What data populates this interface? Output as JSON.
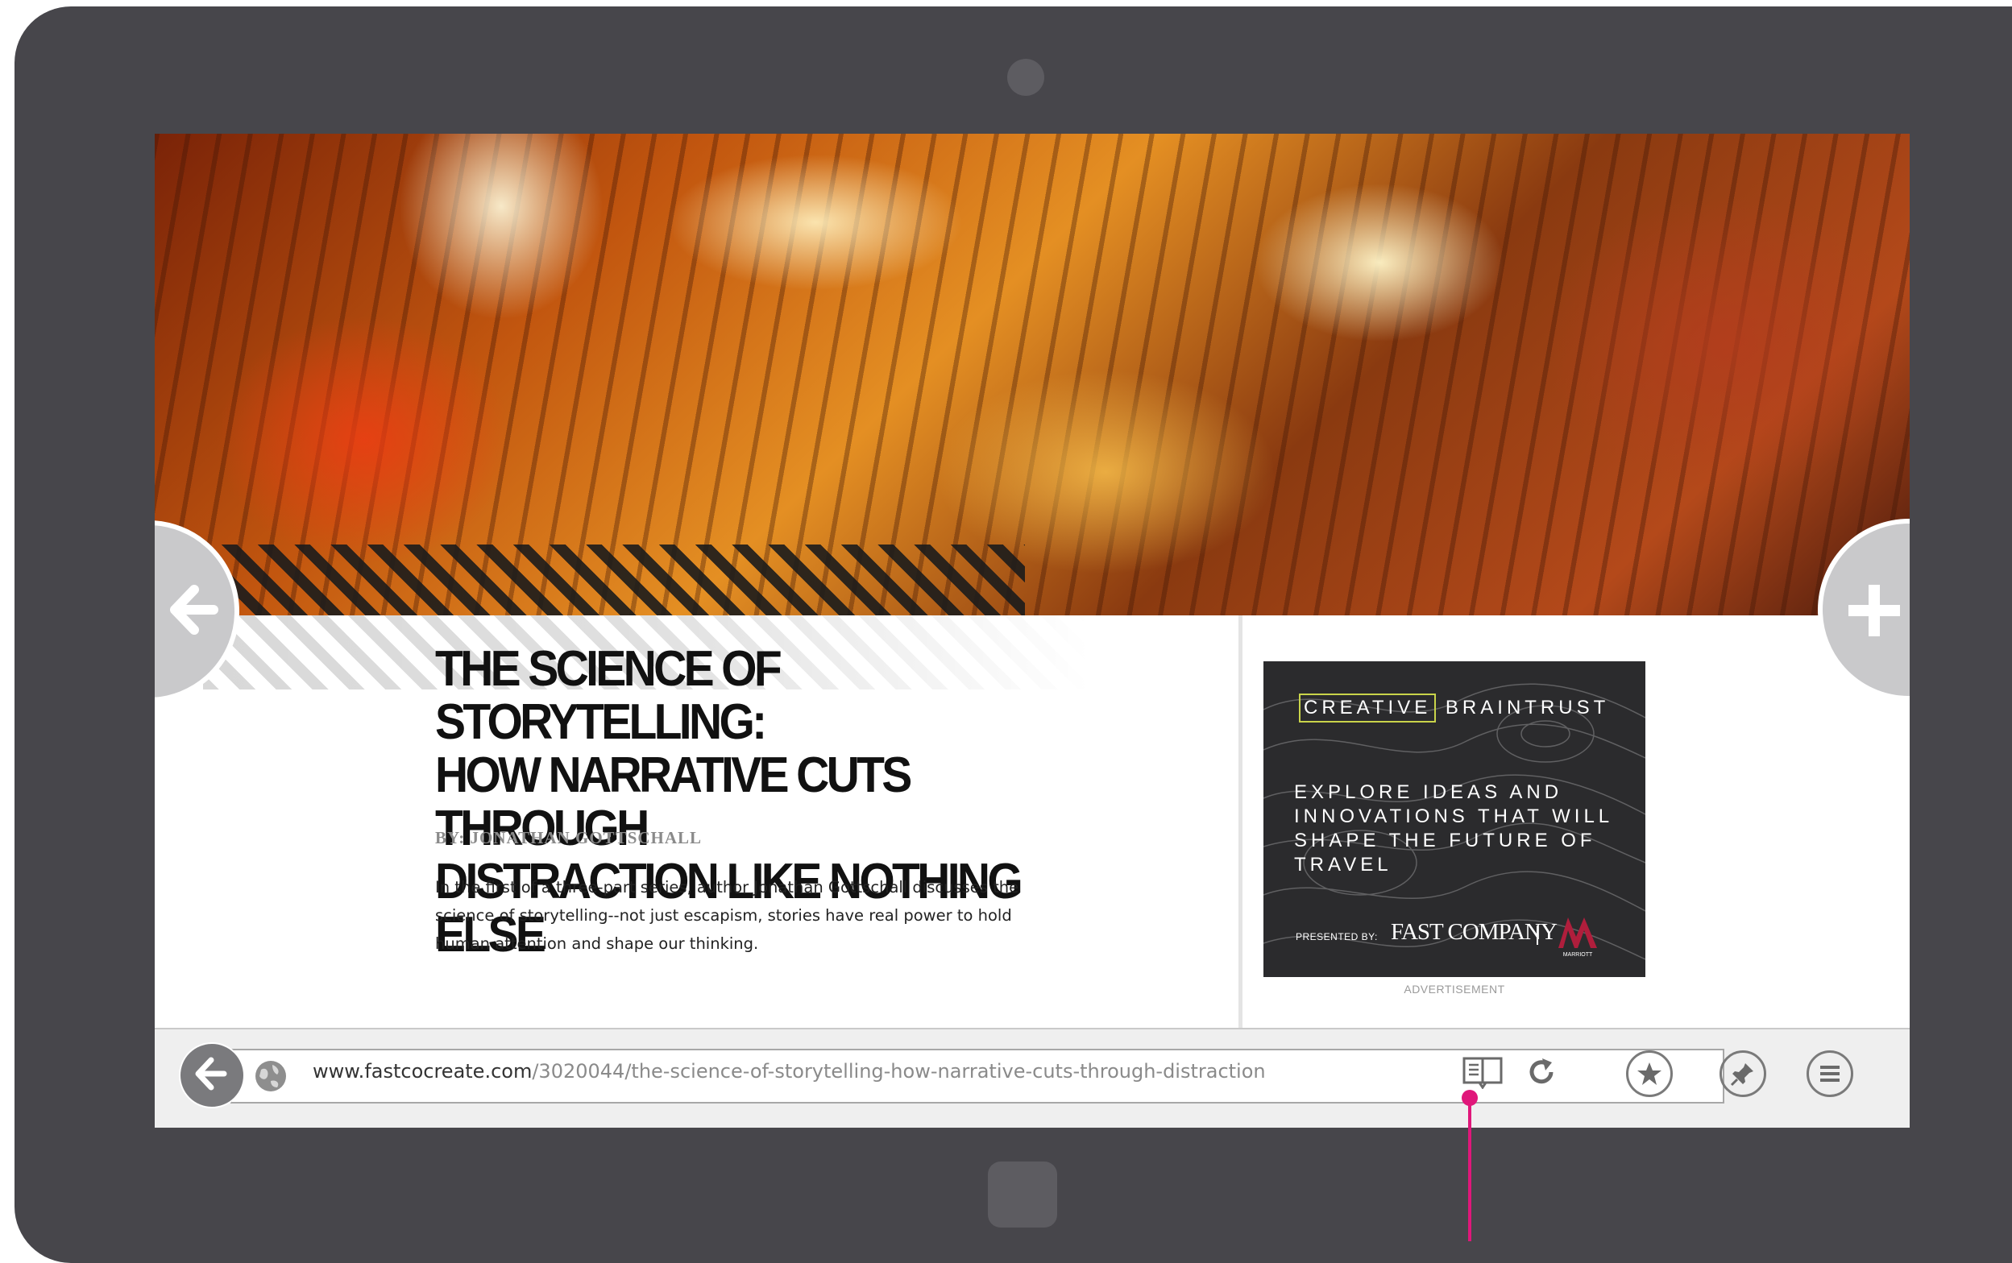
{
  "article": {
    "headline_line1": "THE SCIENCE OF STORYTELLING:",
    "headline_line2": "HOW NARRATIVE CUTS THROUGH",
    "headline_line3": "DISTRACTION LIKE NOTHING ELSE",
    "byline": "BY: JONATHAN GOTTSCHALL",
    "summary": "In the first of a three-part series, author Jonathan Gottschall discusses the science of storytelling--not just escapism, stories have real power to hold human attention and shape our thinking."
  },
  "advertisement": {
    "brand_boxed": "CREATIVE",
    "brand_rest": "BRAINTRUST",
    "headline": "EXPLORE IDEAS AND INNOVATIONS THAT WILL SHAPE THE FUTURE OF TRAVEL",
    "presented_by": "PRESENTED BY:",
    "sponsor": "FAST COMPANY",
    "partner": "MARRIOTT",
    "label": "ADVERTISEMENT"
  },
  "browser": {
    "url_domain": "www.fastcocreate.com",
    "url_path": "/3020044/the-science-of-storytelling-how-narrative-cuts-through-distraction"
  },
  "icons": {
    "back": "back-arrow-icon",
    "globe": "globe-icon",
    "reader": "reading-view-icon",
    "refresh": "refresh-icon",
    "favorites": "star-icon",
    "pin": "pin-icon",
    "menu": "menu-icon",
    "prev": "left-arrow-icon",
    "new_tab": "plus-icon"
  },
  "colors": {
    "device": "#47464b",
    "callout": "#e0177a",
    "ad_accent": "#c9d44a",
    "marriott": "#b01e3c"
  }
}
